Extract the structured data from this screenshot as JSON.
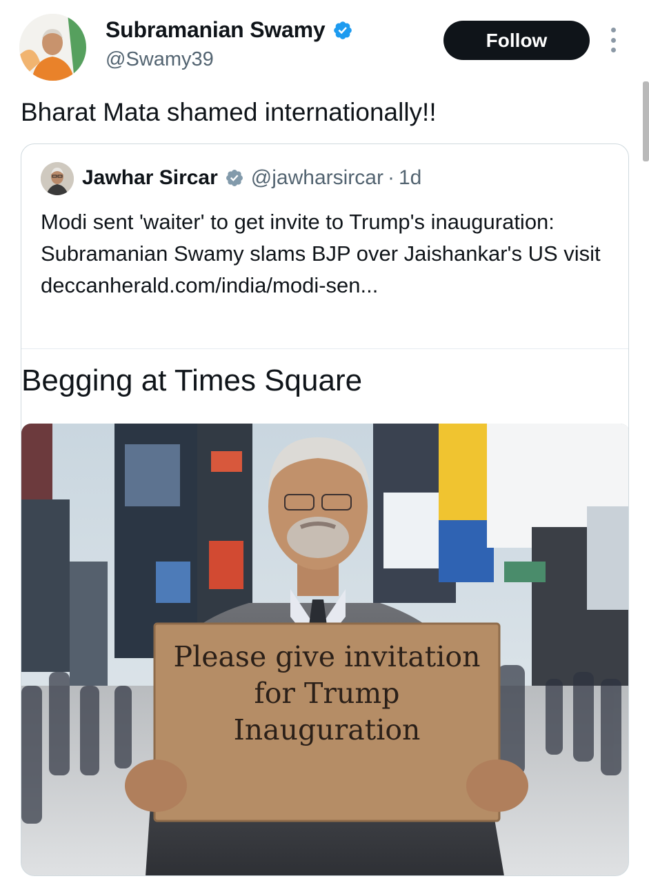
{
  "author": {
    "name": "Subramanian Swamy",
    "handle": "@Swamy39",
    "verified": true
  },
  "follow_label": "Follow",
  "post_text": "Bharat Mata shamed internationally!!",
  "quoted_post": {
    "name": "Jawhar Sircar",
    "handle": "@jawharsircar",
    "separator": "·",
    "time": "1d",
    "verified": true,
    "text": "Modi sent 'waiter' to get invite to Trump's inauguration: Subramanian Swamy slams BJP over Jaishankar's US visit deccanherald.com/india/modi-sen...",
    "caption": "Begging at Times Square",
    "image": {
      "sign_lines": [
        "Please give invitation",
        "for Trump",
        "Inauguration"
      ]
    }
  },
  "colors": {
    "text": "#0f1419",
    "secondary": "#536471",
    "verified_blue": "#1d9bf0",
    "verified_gray": "#829aab",
    "follow_bg": "#0f1419",
    "border": "#cfd9de"
  },
  "icons": {
    "verified": "verified-badge-icon",
    "more": "more-options-icon"
  }
}
